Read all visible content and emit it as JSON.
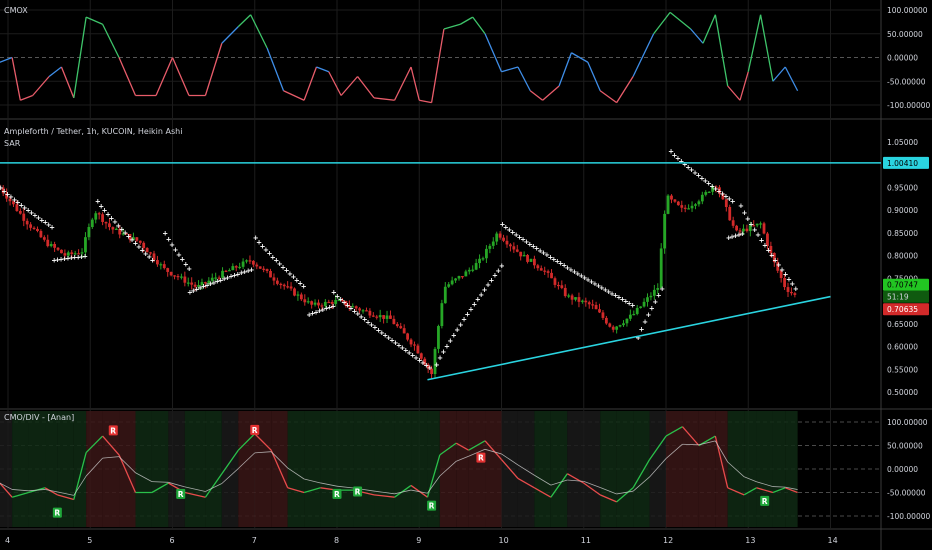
{
  "colors": {
    "bg": "#000000",
    "grid": "#1c1c1c",
    "separator": "#3a3a3a",
    "bull": "#26a626",
    "bear": "#d22a2a",
    "sar": "#ffffff",
    "hline": "#2ad4e0",
    "cmo": "#3f8ee8",
    "cmo_up": "#3ec46a",
    "cmo_down": "#e85c6a",
    "div_red": "#e84b4b",
    "div_green": "#2ac04a",
    "badge_r": "#e33232",
    "badge_g": "#1fa83a"
  },
  "panes": {
    "cmox": {
      "title": "CMOX",
      "axis_labels": [
        "100.00000",
        "50.00000",
        "0.00000",
        "-50.00000",
        "-100.00000"
      ]
    },
    "price": {
      "title": "Ampleforth / Tether, 1h, KUCOIN, Heikin Ashi",
      "indicator": "SAR",
      "axis_labels": [
        "1.05000",
        "0.95000",
        "0.90000",
        "0.85000",
        "0.80000",
        "0.75000",
        "0.65000",
        "0.60000",
        "0.55000",
        "0.50000"
      ],
      "badges": {
        "hline": "1.00410",
        "close": "0.70747",
        "timer": "51:19",
        "low": "0.70635"
      }
    },
    "cmodiv": {
      "title": "CMO/DIV - [Anan]",
      "axis_labels": [
        "100.00000",
        "50.00000",
        "0.00000",
        "-50.00000",
        "-100.00000"
      ],
      "bear_label": "R",
      "bull_label": "R"
    }
  },
  "x_axis": {
    "labels": [
      "4",
      "5",
      "6",
      "7",
      "8",
      "9",
      "10",
      "11",
      "12",
      "13",
      "14"
    ]
  },
  "chart_data": {
    "type": "candlestick",
    "title": "Ampleforth / Tether, 1h, KUCOIN, Heikin Ashi",
    "x_unit": "day",
    "ylim": [
      0.49,
      1.07
    ],
    "y_ticks": [
      1.05,
      0.95,
      0.9,
      0.85,
      0.8,
      0.75,
      0.65,
      0.6,
      0.55,
      0.5
    ],
    "horizontal_line": 1.0041,
    "trendline": {
      "from": [
        9.1,
        0.527
      ],
      "to": [
        14.0,
        0.71
      ]
    },
    "price_path": [
      [
        3.9,
        0.95
      ],
      [
        4.2,
        0.88
      ],
      [
        4.45,
        0.83
      ],
      [
        4.7,
        0.8
      ],
      [
        4.9,
        0.81
      ],
      [
        5.05,
        0.9
      ],
      [
        5.25,
        0.86
      ],
      [
        5.6,
        0.83
      ],
      [
        5.9,
        0.77
      ],
      [
        6.3,
        0.73
      ],
      [
        6.6,
        0.76
      ],
      [
        6.95,
        0.79
      ],
      [
        7.3,
        0.74
      ],
      [
        7.7,
        0.69
      ],
      [
        8.0,
        0.7
      ],
      [
        8.3,
        0.68
      ],
      [
        8.65,
        0.66
      ],
      [
        8.95,
        0.6
      ],
      [
        9.15,
        0.54
      ],
      [
        9.3,
        0.73
      ],
      [
        9.55,
        0.76
      ],
      [
        9.75,
        0.79
      ],
      [
        9.95,
        0.85
      ],
      [
        10.25,
        0.8
      ],
      [
        10.5,
        0.77
      ],
      [
        10.8,
        0.71
      ],
      [
        11.1,
        0.69
      ],
      [
        11.35,
        0.64
      ],
      [
        11.6,
        0.67
      ],
      [
        11.9,
        0.73
      ],
      [
        12.0,
        0.93
      ],
      [
        12.2,
        0.9
      ],
      [
        12.45,
        0.93
      ],
      [
        12.6,
        0.96
      ],
      [
        12.85,
        0.85
      ],
      [
        13.15,
        0.87
      ],
      [
        13.3,
        0.79
      ],
      [
        13.45,
        0.73
      ],
      [
        13.6,
        0.707
      ]
    ],
    "sar_segments": [
      {
        "side": "above",
        "points": [
          [
            3.9,
            0.95
          ],
          [
            4.55,
            0.86
          ]
        ]
      },
      {
        "side": "below",
        "points": [
          [
            4.55,
            0.79
          ],
          [
            4.95,
            0.8
          ]
        ]
      },
      {
        "side": "above",
        "points": [
          [
            5.08,
            0.92
          ],
          [
            5.75,
            0.79
          ]
        ]
      },
      {
        "side": "above",
        "points": [
          [
            5.9,
            0.85
          ],
          [
            6.2,
            0.77
          ]
        ]
      },
      {
        "side": "below",
        "points": [
          [
            6.2,
            0.72
          ],
          [
            6.95,
            0.77
          ]
        ]
      },
      {
        "side": "above",
        "points": [
          [
            7.0,
            0.84
          ],
          [
            7.6,
            0.73
          ]
        ]
      },
      {
        "side": "below",
        "points": [
          [
            7.65,
            0.67
          ],
          [
            7.95,
            0.69
          ]
        ]
      },
      {
        "side": "above",
        "points": [
          [
            7.95,
            0.72
          ],
          [
            9.15,
            0.55
          ]
        ]
      },
      {
        "side": "below",
        "points": [
          [
            9.2,
            0.56
          ],
          [
            10.0,
            0.78
          ]
        ]
      },
      {
        "side": "above",
        "points": [
          [
            10.0,
            0.87
          ],
          [
            11.6,
            0.69
          ]
        ]
      },
      {
        "side": "below",
        "points": [
          [
            11.65,
            0.62
          ],
          [
            11.95,
            0.73
          ]
        ]
      },
      {
        "side": "above",
        "points": [
          [
            12.05,
            1.03
          ],
          [
            12.8,
            0.92
          ]
        ]
      },
      {
        "side": "below",
        "points": [
          [
            12.75,
            0.84
          ],
          [
            12.95,
            0.85
          ]
        ]
      },
      {
        "side": "above",
        "points": [
          [
            12.9,
            0.91
          ],
          [
            13.6,
            0.72
          ]
        ]
      }
    ],
    "cmox": {
      "ylim": [
        -115,
        115
      ],
      "points": [
        [
          3.9,
          -10
        ],
        [
          4.05,
          0
        ],
        [
          4.15,
          -90
        ],
        [
          4.3,
          -80
        ],
        [
          4.5,
          -40
        ],
        [
          4.65,
          -20
        ],
        [
          4.8,
          -85
        ],
        [
          4.95,
          85
        ],
        [
          5.15,
          70
        ],
        [
          5.35,
          0
        ],
        [
          5.55,
          -80
        ],
        [
          5.8,
          -80
        ],
        [
          6.0,
          0
        ],
        [
          6.2,
          -80
        ],
        [
          6.4,
          -80
        ],
        [
          6.6,
          30
        ],
        [
          6.8,
          65
        ],
        [
          6.95,
          90
        ],
        [
          7.15,
          20
        ],
        [
          7.35,
          -70
        ],
        [
          7.6,
          -90
        ],
        [
          7.75,
          -20
        ],
        [
          7.9,
          -30
        ],
        [
          8.05,
          -80
        ],
        [
          8.25,
          -40
        ],
        [
          8.45,
          -85
        ],
        [
          8.7,
          -90
        ],
        [
          8.9,
          -20
        ],
        [
          9.0,
          -90
        ],
        [
          9.15,
          -95
        ],
        [
          9.3,
          60
        ],
        [
          9.5,
          70
        ],
        [
          9.65,
          85
        ],
        [
          9.8,
          50
        ],
        [
          10.0,
          -30
        ],
        [
          10.2,
          -20
        ],
        [
          10.35,
          -70
        ],
        [
          10.5,
          -90
        ],
        [
          10.7,
          -60
        ],
        [
          10.85,
          10
        ],
        [
          11.05,
          -10
        ],
        [
          11.2,
          -70
        ],
        [
          11.4,
          -95
        ],
        [
          11.6,
          -40
        ],
        [
          11.85,
          50
        ],
        [
          12.05,
          95
        ],
        [
          12.3,
          60
        ],
        [
          12.45,
          30
        ],
        [
          12.6,
          90
        ],
        [
          12.75,
          -60
        ],
        [
          12.9,
          -90
        ],
        [
          13.0,
          -30
        ],
        [
          13.15,
          90
        ],
        [
          13.3,
          -50
        ],
        [
          13.45,
          -20
        ],
        [
          13.6,
          -70
        ]
      ]
    },
    "cmo_div": {
      "ylim": [
        -115,
        115
      ],
      "points": [
        [
          3.9,
          -30
        ],
        [
          4.05,
          -60
        ],
        [
          4.25,
          -50
        ],
        [
          4.45,
          -40
        ],
        [
          4.6,
          -55
        ],
        [
          4.8,
          -65
        ],
        [
          4.95,
          35
        ],
        [
          5.15,
          70
        ],
        [
          5.35,
          30
        ],
        [
          5.55,
          -50
        ],
        [
          5.75,
          -50
        ],
        [
          5.95,
          -30
        ],
        [
          6.15,
          -50
        ],
        [
          6.4,
          -60
        ],
        [
          6.6,
          -10
        ],
        [
          6.8,
          40
        ],
        [
          7.0,
          75
        ],
        [
          7.2,
          40
        ],
        [
          7.4,
          -40
        ],
        [
          7.6,
          -50
        ],
        [
          7.8,
          -40
        ],
        [
          8.0,
          -45
        ],
        [
          8.2,
          -45
        ],
        [
          8.45,
          -55
        ],
        [
          8.7,
          -60
        ],
        [
          8.9,
          -35
        ],
        [
          9.1,
          -60
        ],
        [
          9.25,
          30
        ],
        [
          9.45,
          55
        ],
        [
          9.6,
          40
        ],
        [
          9.8,
          60
        ],
        [
          10.0,
          20
        ],
        [
          10.2,
          -20
        ],
        [
          10.4,
          -40
        ],
        [
          10.6,
          -60
        ],
        [
          10.8,
          -10
        ],
        [
          11.0,
          -30
        ],
        [
          11.2,
          -55
        ],
        [
          11.4,
          -70
        ],
        [
          11.6,
          -40
        ],
        [
          11.8,
          20
        ],
        [
          12.0,
          70
        ],
        [
          12.2,
          90
        ],
        [
          12.4,
          50
        ],
        [
          12.6,
          70
        ],
        [
          12.75,
          -40
        ],
        [
          12.95,
          -55
        ],
        [
          13.1,
          -40
        ],
        [
          13.3,
          -50
        ],
        [
          13.45,
          -40
        ],
        [
          13.6,
          -50
        ]
      ],
      "bear_divergence_labels": [
        [
          5.28,
          80
        ],
        [
          7.0,
          81
        ],
        [
          9.75,
          22
        ]
      ],
      "bull_divergence_labels": [
        [
          4.6,
          -95
        ],
        [
          6.1,
          -55
        ],
        [
          8.0,
          -55
        ],
        [
          8.25,
          -50
        ],
        [
          9.15,
          -80
        ],
        [
          13.2,
          -70
        ]
      ]
    }
  }
}
